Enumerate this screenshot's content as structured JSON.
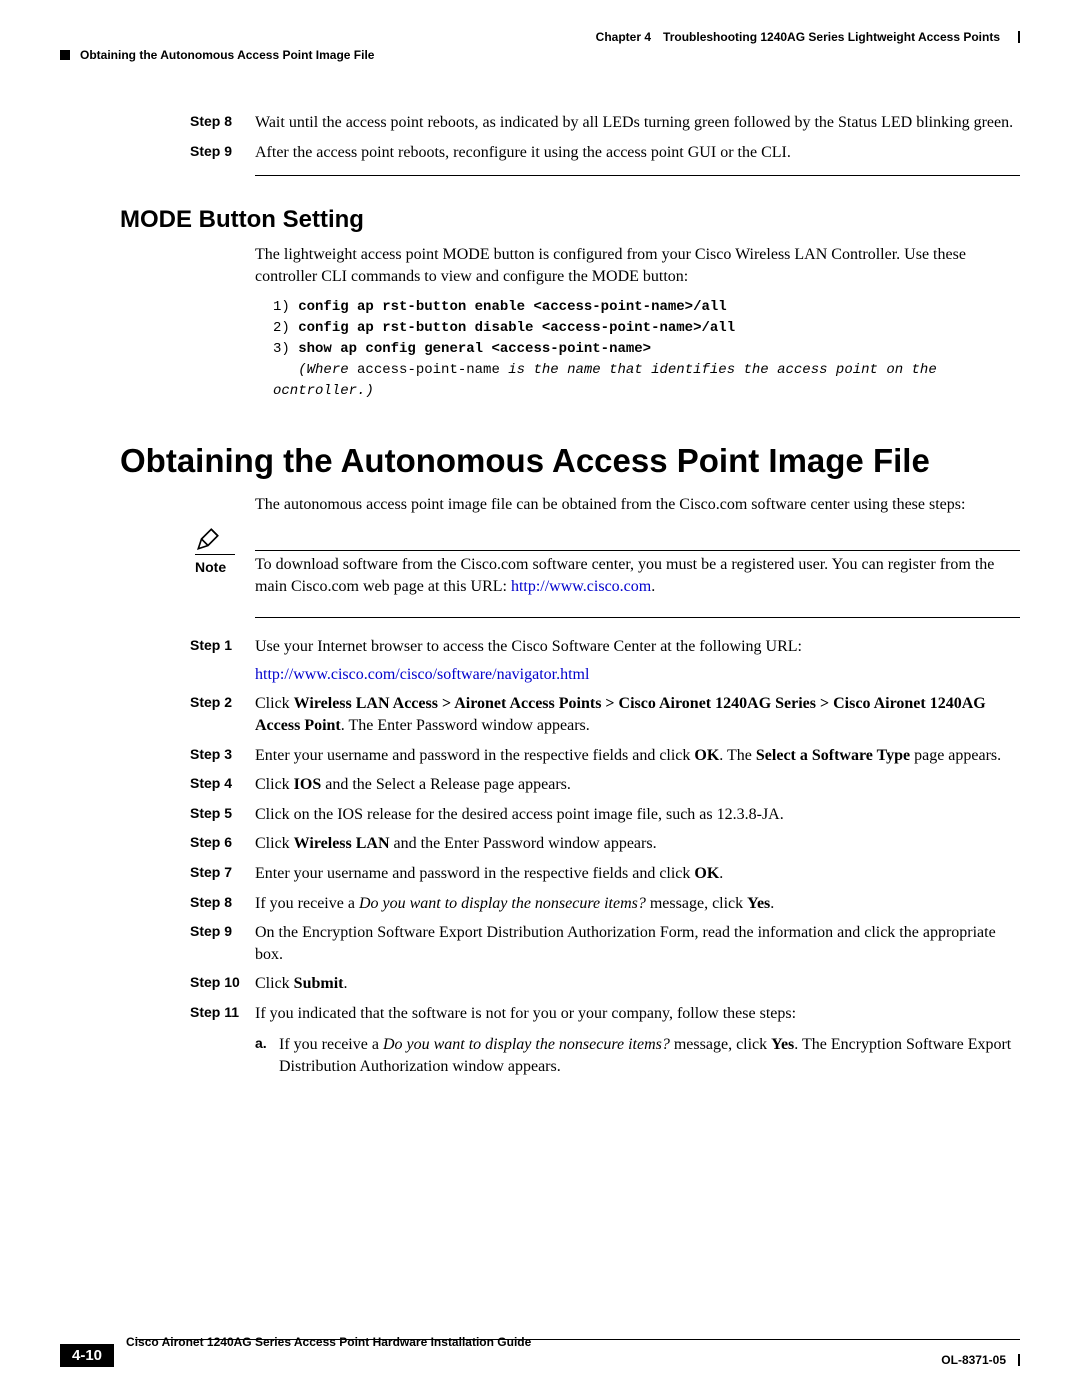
{
  "header": {
    "chapter_label": "Chapter 4",
    "chapter_title": "Troubleshooting 1240AG Series Lightweight Access Points",
    "section_crumb": "Obtaining the Autonomous Access Point Image File"
  },
  "top_steps": {
    "s8": {
      "label": "Step 8",
      "text": "Wait until the access point reboots, as indicated by all LEDs turning green followed by the Status LED blinking green."
    },
    "s9": {
      "label": "Step 9",
      "text": "After the access point reboots, reconfigure it using the access point GUI or the CLI."
    }
  },
  "mode_section": {
    "heading": "MODE Button Setting",
    "intro": "The lightweight access point MODE button is configured from your Cisco Wireless LAN Controller. Use these controller CLI commands to view and configure the MODE button:",
    "cli": {
      "l1_num": "1)",
      "l1_cmd": "config ap rst-button enable <access-point-name>/all",
      "l2_num": "2)",
      "l2_cmd": "config ap rst-button disable <access-point-name>/all",
      "l3_num": "3)",
      "l3_cmd": "show ap config general <access-point-name>",
      "where_pre": "(Where ",
      "where_var": "access-point-name",
      "where_post": " is the name that identifies the access point on the ocntroller.)"
    }
  },
  "obtain_section": {
    "heading": "Obtaining the Autonomous Access Point Image File",
    "intro": "The autonomous access point image file can be obtained from the Cisco.com software center using these steps:",
    "note": {
      "label": "Note",
      "pre": "To download software from the Cisco.com software center, you must be a registered user. You can register from the main Cisco.com web page at this URL: ",
      "url": "http://www.cisco.com",
      "post": "."
    },
    "steps": {
      "s1": {
        "label": "Step 1",
        "text": "Use your Internet browser to access the Cisco Software Center at the following URL:",
        "url": "http://www.cisco.com/cisco/software/navigator.html"
      },
      "s2": {
        "label": "Step 2",
        "pre": "Click ",
        "bold_path": "Wireless LAN Access > Aironet Access Points > Cisco Aironet 1240AG Series > Cisco Aironet 1240AG Access Point",
        "post": ". The Enter Password window appears."
      },
      "s3": {
        "label": "Step 3",
        "pre": "Enter your username and password in the respective fields and click ",
        "b1": "OK",
        "mid": ". The ",
        "b2": "Select a Software Type",
        "post": " page appears."
      },
      "s4": {
        "label": "Step 4",
        "pre": "Click ",
        "b1": "IOS",
        "post": " and the Select a Release page appears."
      },
      "s5": {
        "label": "Step 5",
        "text": "Click on the IOS release for the desired access point image file, such as 12.3.8-JA."
      },
      "s6": {
        "label": "Step 6",
        "pre": "Click ",
        "b1": "Wireless LAN",
        "post": " and the Enter Password window appears."
      },
      "s7": {
        "label": "Step 7",
        "pre": "Enter your username and password in the respective fields and click ",
        "b1": "OK",
        "post": "."
      },
      "s8": {
        "label": "Step 8",
        "pre": "If you receive a ",
        "ital": "Do you want to display the nonsecure items?",
        "mid": " message, click ",
        "b1": "Yes",
        "post": "."
      },
      "s9": {
        "label": "Step 9",
        "text": "On the Encryption Software Export Distribution Authorization Form, read the information and click the appropriate box."
      },
      "s10": {
        "label": "Step 10",
        "pre": "Click ",
        "b1": "Submit",
        "post": "."
      },
      "s11": {
        "label": "Step 11",
        "text": "If you indicated that the software is not for you or your company, follow these steps:",
        "sub_a": {
          "label": "a.",
          "pre": "If you receive a ",
          "ital": "Do you want to display the nonsecure items?",
          "mid": " message, click ",
          "b1": "Yes",
          "post": ". The Encryption Software Export Distribution Authorization window appears."
        }
      }
    }
  },
  "footer": {
    "guide_title": "Cisco Aironet 1240AG Series Access Point Hardware Installation Guide",
    "page_num": "4-10",
    "doc_id": "OL-8371-05"
  }
}
